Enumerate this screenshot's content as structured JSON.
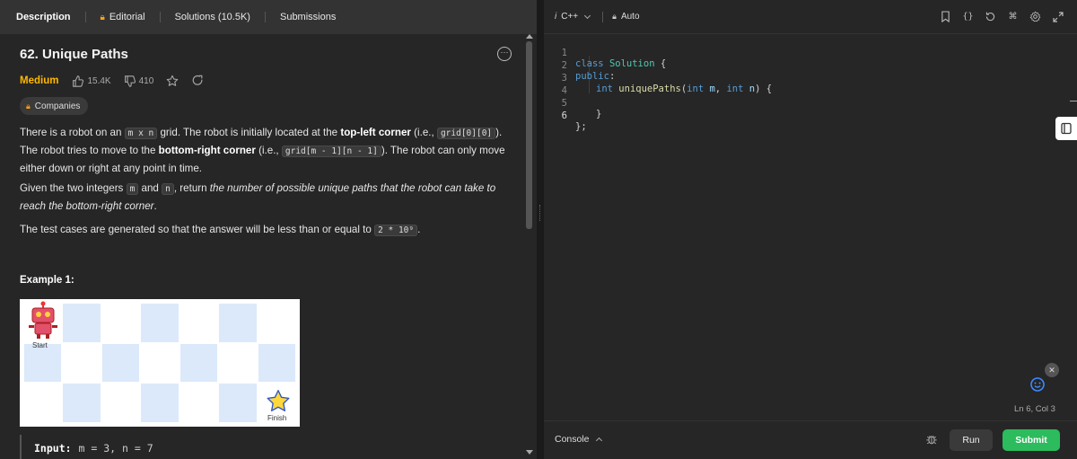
{
  "tabs": {
    "description": "Description",
    "editorial": "Editorial",
    "solutions": "Solutions (10.5K)",
    "submissions": "Submissions"
  },
  "problem": {
    "title": "62. Unique Paths",
    "difficulty": "Medium",
    "likes": "15.4K",
    "dislikes": "410",
    "companies": "Companies",
    "description": {
      "p1_a": "There is a robot on an ",
      "p1_code1": "m x n",
      "p1_b": " grid. The robot is initially located at the ",
      "p1_bold1": "top-left corner",
      "p1_c": " (i.e., ",
      "p1_code2": "grid[0][0]",
      "p1_d": "). The robot tries to move to the ",
      "p1_bold2": "bottom-right corner",
      "p1_e": " (i.e., ",
      "p1_code3": "grid[m - 1][n - 1]",
      "p1_f": "). The robot can only move either down or right at any point in time.",
      "p2_a": "Given the two integers ",
      "p2_code1": "m",
      "p2_b": " and ",
      "p2_code2": "n",
      "p2_c": ", return ",
      "p2_italic": "the number of possible unique paths that the robot can take to reach the bottom-right corner",
      "p2_d": ".",
      "p3_a": "The test cases are generated so that the answer will be less than or equal to ",
      "p3_code": "2 * 10⁹",
      "p3_b": "."
    },
    "example_title": "Example 1:",
    "example_grid_start": "Start",
    "example_grid_finish": "Finish",
    "example_input_label": "Input:",
    "example_input_value": "m = 3, n = 7"
  },
  "editor": {
    "language": "C++",
    "language_prefix": "i",
    "mode": "Auto",
    "code_lines": [
      {
        "n": "1"
      },
      {
        "n": "2"
      },
      {
        "n": "3"
      },
      {
        "n": "4"
      },
      {
        "n": "5"
      },
      {
        "n": "6"
      }
    ],
    "code_text": {
      "l1_kw": "class",
      "l1_ty": "Solution",
      "l1_pl": " {",
      "l2_kw": "public",
      "l2_pl": ":",
      "l3_ty": "int",
      "l3_fn": "uniquePaths",
      "l3_p1": "(",
      "l3_t1": "int",
      "l3_a1": "m",
      "l3_p2": ", ",
      "l3_t2": "int",
      "l3_a2": "n",
      "l3_p3": ") {",
      "l5_pl": "}",
      "l6_pl": "};"
    },
    "cursor_position": "Ln 6, Col 3",
    "header_icons": [
      "bookmark-icon",
      "code-braces-icon",
      "reset-icon",
      "command-icon",
      "settings-icon",
      "expand-icon"
    ]
  },
  "bottom": {
    "console": "Console",
    "run": "Run",
    "submit": "Submit"
  },
  "colors": {
    "accent_orange": "#ffa116",
    "difficulty_medium": "#ffb800",
    "submit_green": "#2cbb5d",
    "grid_light": "#dbe9fb"
  },
  "example_grid": {
    "rows": 3,
    "cols": 7
  }
}
